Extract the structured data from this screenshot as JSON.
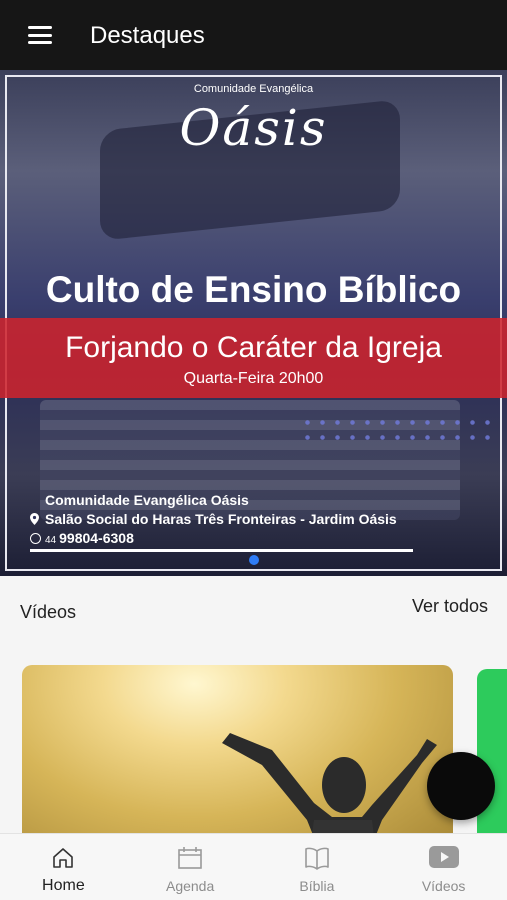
{
  "header": {
    "title": "Destaques",
    "menu_icon": "hamburger-menu-icon"
  },
  "banner": {
    "logo_small": "Comunidade Evangélica",
    "logo_big": "Oásis",
    "heading": "Culto de Ensino Bíblico",
    "subheading": "Forjando o Caráter da Igreja",
    "when": "Quarta-Feira 20h00",
    "org": "Comunidade Evangélica Oásis",
    "address": "Salão Social do Haras Três Fronteiras - Jardim Oásis",
    "phone_prefix": "44",
    "phone": "99804-6308",
    "accent_color": "#cd232d",
    "active_dot_color": "#2f7df6"
  },
  "videos": {
    "title": "Vídeos",
    "see_all": "Ver todos"
  },
  "bottom_nav": {
    "items": [
      {
        "label": "Home",
        "icon": "home-icon",
        "active": true
      },
      {
        "label": "Agenda",
        "icon": "calendar-icon",
        "active": false
      },
      {
        "label": "Bíblia",
        "icon": "book-icon",
        "active": false
      },
      {
        "label": "Vídeos",
        "icon": "video-play-icon",
        "active": false
      }
    ]
  }
}
